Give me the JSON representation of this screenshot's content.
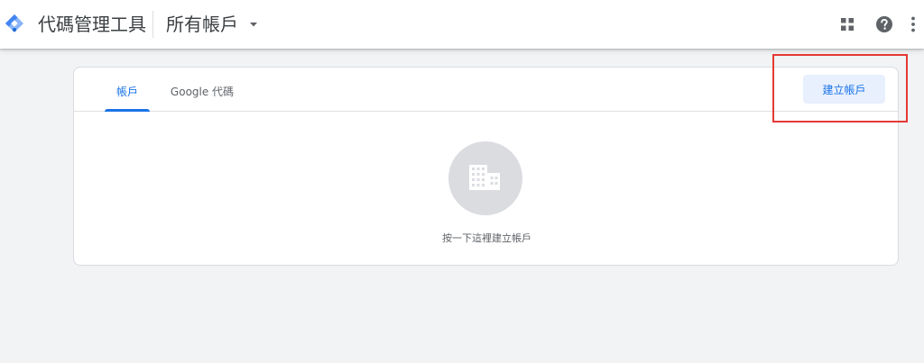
{
  "header": {
    "app_title": "代碼管理工具",
    "account_selector_label": "所有帳戶",
    "icons": [
      "tag-manager-logo",
      "caret-down-icon",
      "apps-grid-icon",
      "help-icon",
      "more-vert-icon"
    ]
  },
  "card": {
    "tabs": [
      {
        "label": "帳戶",
        "active": true
      },
      {
        "label": "Google 代碼",
        "active": false
      }
    ],
    "create_button_label": "建立帳戶",
    "empty_state_text": "按一下這裡建立帳戶",
    "empty_state_icon": "building-icon"
  },
  "colors": {
    "accent": "#1a73e8",
    "button_bg": "#e8f0fe",
    "page_bg": "#f1f3f4",
    "highlight": "#e53935"
  }
}
